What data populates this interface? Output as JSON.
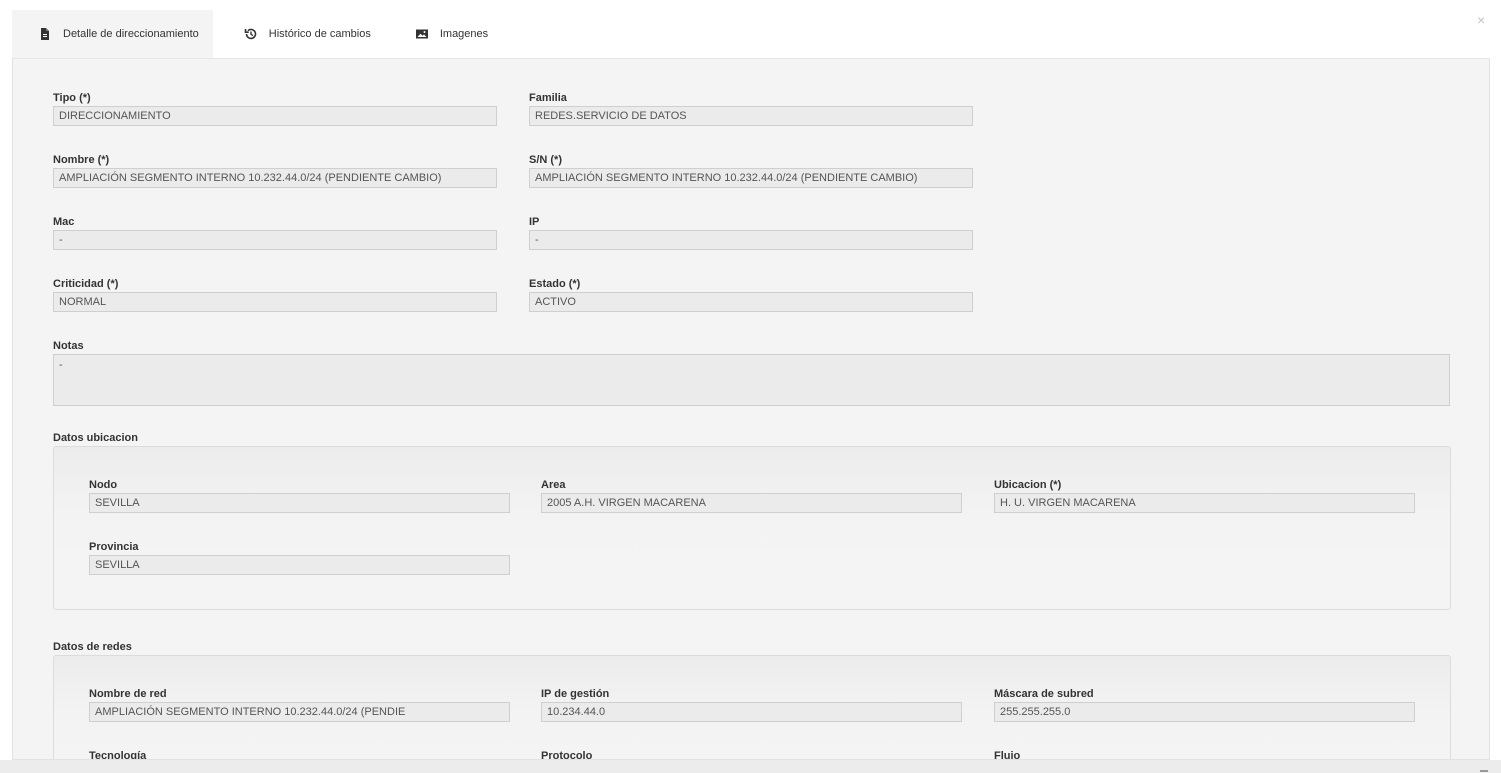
{
  "close_label": "×",
  "tabs": [
    {
      "label": "Detalle de direccionamiento",
      "icon": "document-icon",
      "active": true
    },
    {
      "label": "Histórico de cambios",
      "icon": "history-icon",
      "active": false
    },
    {
      "label": "Imagenes",
      "icon": "image-icon",
      "active": false
    }
  ],
  "fields": {
    "tipo": {
      "label": "Tipo (*)",
      "value": "DIRECCIONAMIENTO"
    },
    "familia": {
      "label": "Familia",
      "value": "REDES.SERVICIO DE DATOS"
    },
    "nombre": {
      "label": "Nombre (*)",
      "value": "AMPLIACIÓN SEGMENTO INTERNO 10.232.44.0/24 (PENDIENTE CAMBIO)"
    },
    "sn": {
      "label": "S/N (*)",
      "value": "AMPLIACIÓN SEGMENTO INTERNO 10.232.44.0/24 (PENDIENTE CAMBIO)"
    },
    "mac": {
      "label": "Mac",
      "value": "-"
    },
    "ip": {
      "label": "IP",
      "value": "-"
    },
    "criticidad": {
      "label": "Criticidad (*)",
      "value": "NORMAL"
    },
    "estado": {
      "label": "Estado (*)",
      "value": "ACTIVO"
    },
    "notas": {
      "label": "Notas",
      "value": "-"
    }
  },
  "ubicacion": {
    "title": "Datos ubicacion",
    "nodo": {
      "label": "Nodo",
      "value": "SEVILLA"
    },
    "area": {
      "label": "Area",
      "value": "2005 A.H. VIRGEN MACARENA"
    },
    "ubicacion": {
      "label": "Ubicacion (*)",
      "value": "H. U. VIRGEN MACARENA"
    },
    "provincia": {
      "label": "Provincia",
      "value": "SEVILLA"
    }
  },
  "redes": {
    "title": "Datos de redes",
    "nombre_red": {
      "label": "Nombre de red",
      "value": "AMPLIACIÓN SEGMENTO INTERNO 10.232.44.0/24 (PENDIE"
    },
    "ip_gestion": {
      "label": "IP de gestión",
      "value": "10.234.44.0"
    },
    "mascara": {
      "label": "Máscara de subred",
      "value": "255.255.255.0"
    },
    "tecnologia": {
      "label": "Tecnología"
    },
    "protocolo": {
      "label": "Protocolo"
    },
    "flujo": {
      "label": "Flujo"
    }
  }
}
